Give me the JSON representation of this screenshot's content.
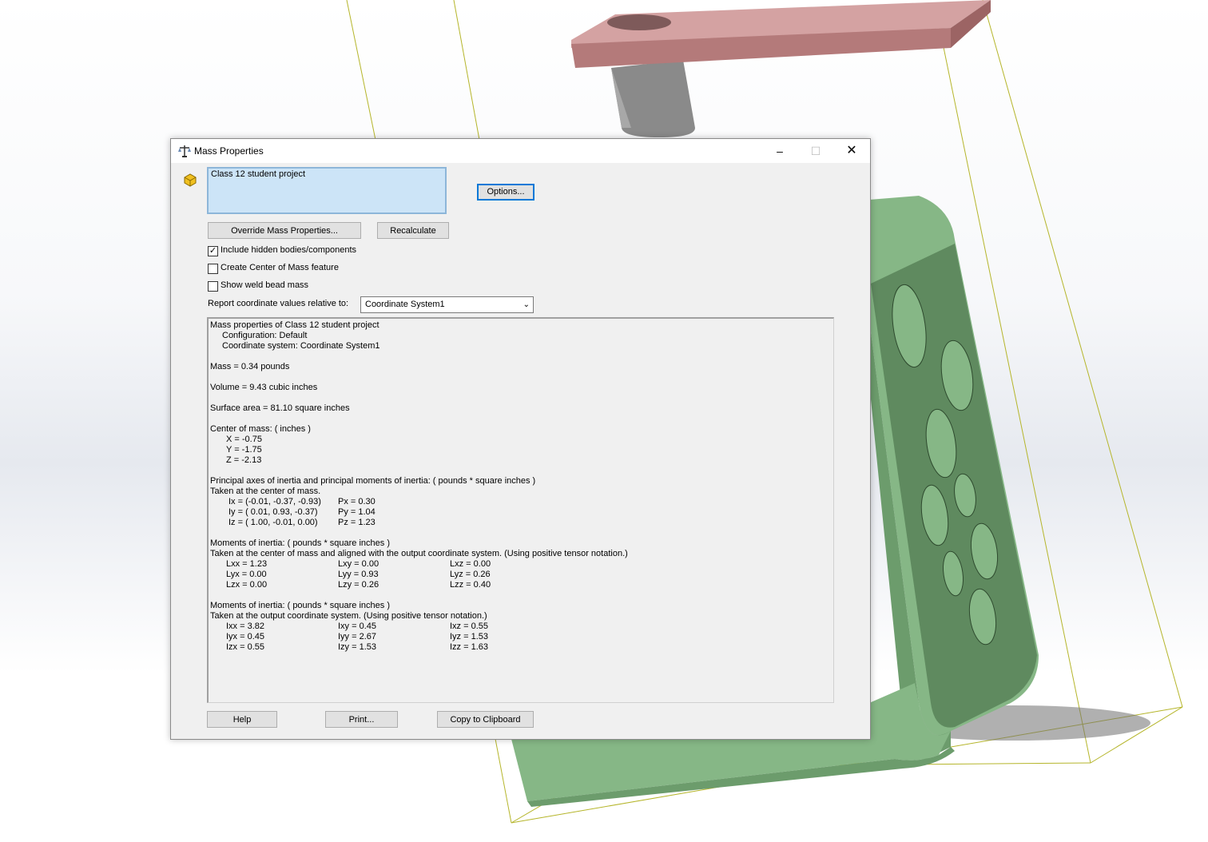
{
  "window": {
    "title": "Mass Properties",
    "minimize": "–",
    "maximize": "☐",
    "close": "✕"
  },
  "selection": {
    "value": "Class 12 student project"
  },
  "buttons": {
    "options": "Options...",
    "override": "Override Mass Properties...",
    "recalculate": "Recalculate",
    "help": "Help",
    "print": "Print...",
    "copy": "Copy to Clipboard"
  },
  "checkboxes": [
    {
      "label": "Include hidden bodies/components",
      "checked": true,
      "mark": "✓"
    },
    {
      "label": "Create Center of Mass feature",
      "checked": false,
      "mark": ""
    },
    {
      "label": "Show weld bead mass",
      "checked": false,
      "mark": ""
    }
  ],
  "report": {
    "label": "Report coordinate values relative to:",
    "selected": "Coordinate System1"
  },
  "results": {
    "header": "Mass properties of Class 12 student project",
    "configuration": "Configuration: Default",
    "coordinate_system": "Coordinate system: Coordinate System1",
    "mass": "Mass = 0.34 pounds",
    "volume": "Volume = 9.43 cubic inches",
    "surface_area": "Surface area = 81.10 square inches",
    "com_title": "Center of mass: ( inches )",
    "com_x": "X = -0.75",
    "com_y": "Y = -1.75",
    "com_z": "Z = -2.13",
    "principal_title": "Principal axes of inertia and principal moments of inertia: ( pounds * square inches )",
    "principal_taken": "Taken at the center of mass.",
    "principal_rows": [
      {
        "axis": "Ix = (-0.01, -0.37, -0.93)",
        "moment": "Px = 0.30"
      },
      {
        "axis": "Iy = ( 0.01,  0.93, -0.37)",
        "moment": "Py = 1.04"
      },
      {
        "axis": "Iz = ( 1.00, -0.01,  0.00)",
        "moment": "Pz = 1.23"
      }
    ],
    "moi_com_title": "Moments of inertia: ( pounds * square inches )",
    "moi_com_taken": "Taken at the center of mass and aligned with the output coordinate system. (Using positive tensor notation.)",
    "moi_com_rows": [
      [
        "Lxx = 1.23",
        "Lxy = 0.00",
        "Lxz = 0.00"
      ],
      [
        "Lyx = 0.00",
        "Lyy = 0.93",
        "Lyz = 0.26"
      ],
      [
        "Lzx = 0.00",
        "Lzy = 0.26",
        "Lzz = 0.40"
      ]
    ],
    "moi_out_title": "Moments of inertia: ( pounds * square inches )",
    "moi_out_taken": "Taken at the output coordinate system. (Using positive tensor notation.)",
    "moi_out_rows": [
      [
        "Ixx = 3.82",
        "Ixy = 0.45",
        "Ixz = 0.55"
      ],
      [
        "Iyx = 0.45",
        "Iyy = 2.67",
        "Iyz = 1.53"
      ],
      [
        "Izx = 0.55",
        "Izy = 1.53",
        "Izz = 1.63"
      ]
    ]
  },
  "colors": {
    "part_green": "#86b786",
    "part_face_dark": "#5f8a5f",
    "plate_pink": "#c48a8a",
    "post_gray": "#8a8a8a",
    "bbox_line": "#b5b52a",
    "selection_bg": "#cce4f7",
    "default_button_border": "#0078d7"
  },
  "icons": {
    "title": "balance-scale-icon",
    "part": "part-icon",
    "dropdown": "chevron-down-icon"
  }
}
